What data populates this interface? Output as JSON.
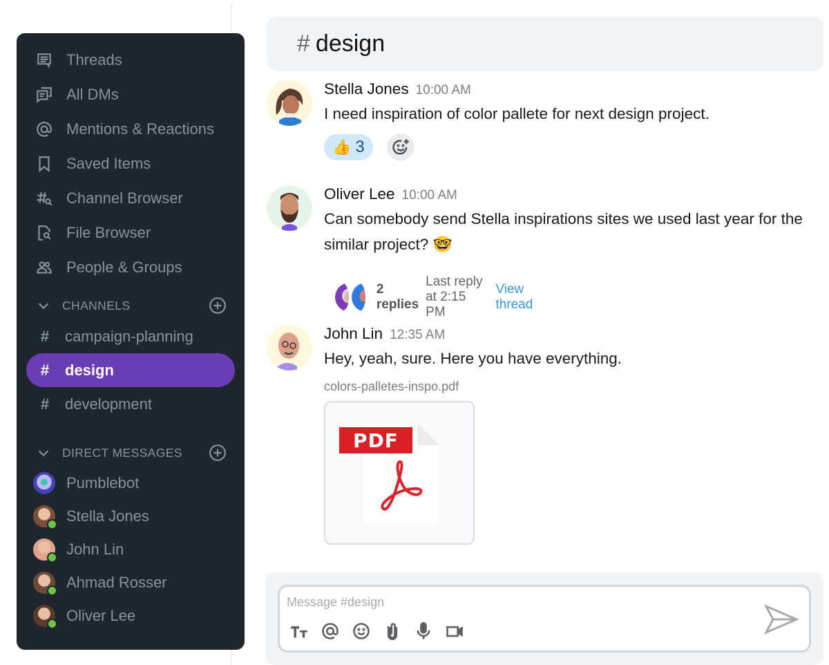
{
  "sidebar": {
    "nav": [
      {
        "label": "Threads",
        "icon": "threads-icon"
      },
      {
        "label": "All DMs",
        "icon": "all-dms-icon"
      },
      {
        "label": "Mentions & Reactions",
        "icon": "at-icon"
      },
      {
        "label": "Saved Items",
        "icon": "bookmark-icon"
      },
      {
        "label": "Channel Browser",
        "icon": "channel-search-icon"
      },
      {
        "label": "File Browser",
        "icon": "file-search-icon"
      },
      {
        "label": "People & Groups",
        "icon": "people-icon"
      }
    ],
    "channels_heading": "CHANNELS",
    "channels": [
      {
        "hash": "#",
        "name": "campaign-planning",
        "active": false
      },
      {
        "hash": "#",
        "name": "design",
        "active": true
      },
      {
        "hash": "#",
        "name": "development",
        "active": false
      }
    ],
    "dms_heading": "DIRECT MESSAGES",
    "dms": [
      {
        "name": "Pumblebot",
        "online": false,
        "avatar_color": "#3f44b8"
      },
      {
        "name": "Stella Jones",
        "online": true,
        "avatar_color": "#7a4e3b"
      },
      {
        "name": "John Lin",
        "online": true,
        "avatar_color": "#e0a58a"
      },
      {
        "name": "Ahmad Rosser",
        "online": true,
        "avatar_color": "#6b4a3a"
      },
      {
        "name": "Oliver Lee",
        "online": true,
        "avatar_color": "#5a3a2c"
      }
    ],
    "colors": {
      "background": "#1f262d",
      "active": "#6a3cb6",
      "online": "#6cc644"
    }
  },
  "header": {
    "hash": "#",
    "title": "design"
  },
  "messages": [
    {
      "author": "Stella Jones",
      "time": "10:00 AM",
      "text": "I need inspiration of color pallete for next design project.",
      "reactions": [
        {
          "emoji": "👍",
          "count": "3"
        }
      ]
    },
    {
      "author": "Oliver Lee",
      "time": "10:00 AM",
      "text": "Can somebody send Stella inspirations sites we used last year for the similar project? 🤓",
      "thread": {
        "replies": "2 replies",
        "last_reply": "Last reply at 2:15 PM",
        "view_label": "View thread"
      }
    },
    {
      "author": "John Lin",
      "time": "12:35 AM",
      "text": "Hey, yeah, sure. Here you have everything.",
      "attachment": {
        "filename": "colors-palletes-inspo.pdf",
        "badge": "PDF"
      }
    }
  ],
  "composer": {
    "placeholder": "Message #design",
    "tools": [
      "text-format-icon",
      "mention-icon",
      "emoji-icon",
      "attachment-icon",
      "microphone-icon",
      "video-icon"
    ]
  }
}
